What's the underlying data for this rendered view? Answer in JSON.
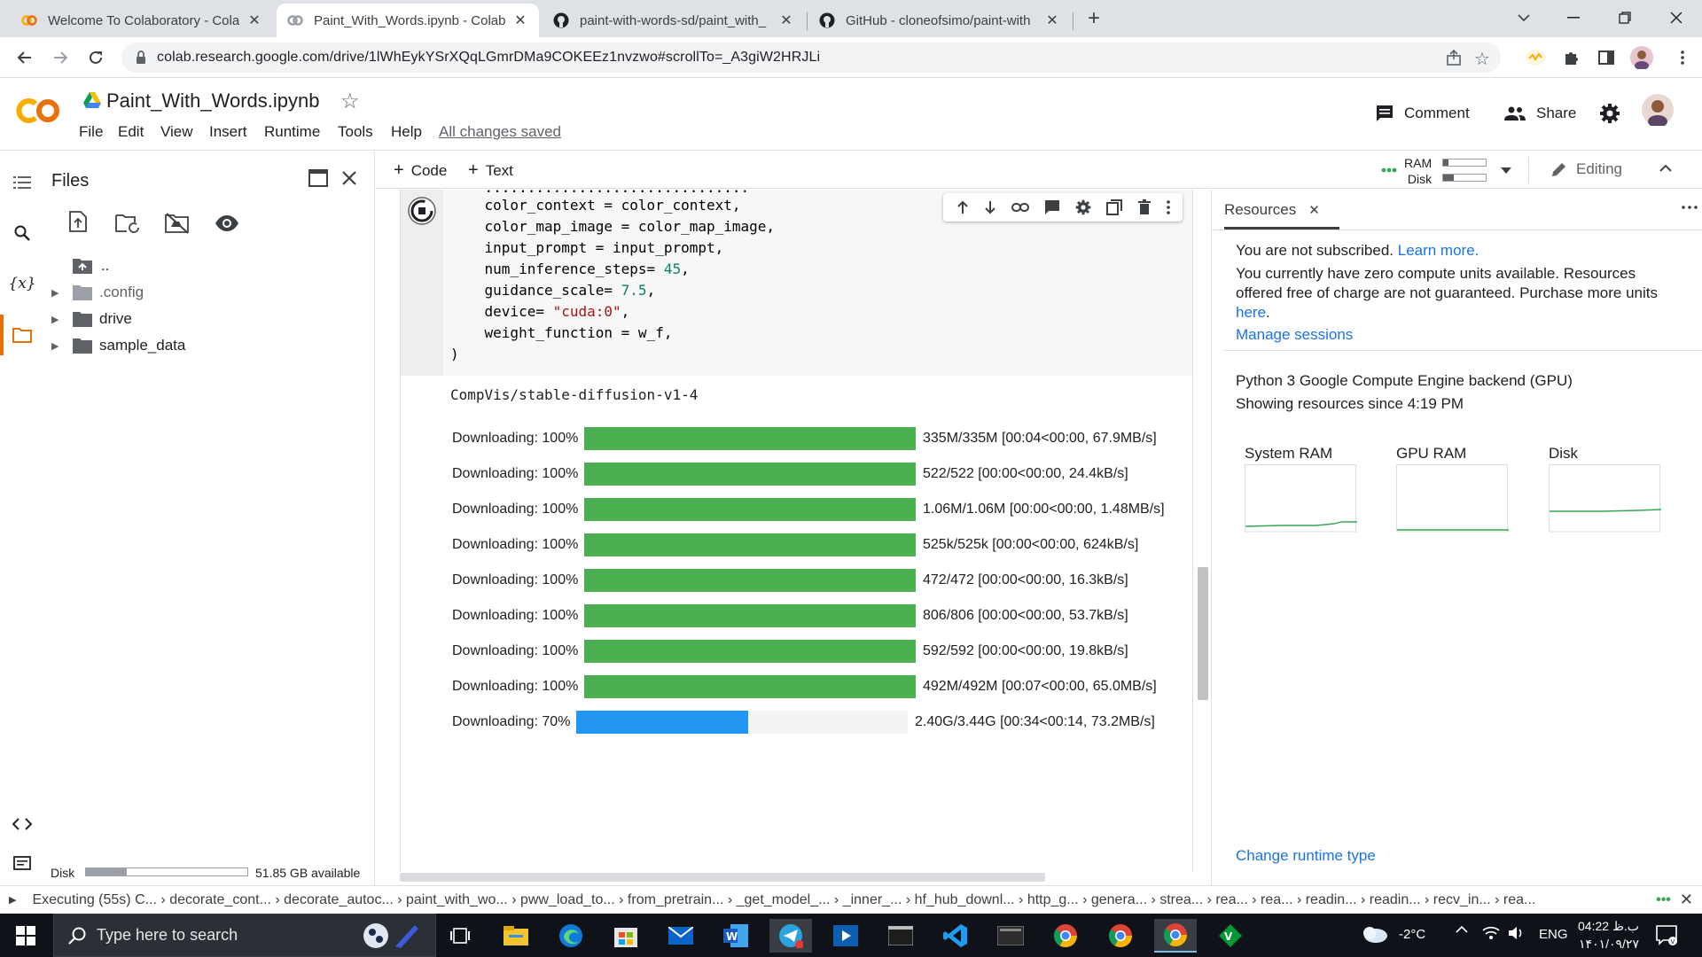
{
  "browser": {
    "tabs": [
      {
        "title": "Welcome To Colaboratory - Colal",
        "favicon": "colab-icon"
      },
      {
        "title": "Paint_With_Words.ipynb - Colabo",
        "favicon": "colab-icon"
      },
      {
        "title": "paint-with-words-sd/paint_with_",
        "favicon": "github-icon"
      },
      {
        "title": "GitHub - cloneofsimo/paint-with",
        "favicon": "github-icon"
      }
    ],
    "url": "colab.research.google.com/drive/1lWhEykYSrXQqLGmrDMa9COKEEz1nvzwo#scrollTo=_A3giW2HRJLi"
  },
  "colab": {
    "doc_title": "Paint_With_Words.ipynb",
    "menu": [
      "File",
      "Edit",
      "View",
      "Insert",
      "Runtime",
      "Tools",
      "Help"
    ],
    "saved_status": "All changes saved",
    "comment_label": "Comment",
    "share_label": "Share",
    "add_code": "Code",
    "add_text": "Text",
    "ram_label": "RAM",
    "disk_label": "Disk",
    "editing_label": "Editing"
  },
  "files": {
    "title": "Files",
    "items": [
      {
        "name": "..",
        "type": "up"
      },
      {
        "name": ".config",
        "type": "folder"
      },
      {
        "name": "drive",
        "type": "folder"
      },
      {
        "name": "sample_data",
        "type": "folder"
      }
    ],
    "disk_label": "Disk",
    "disk_available": "51.85 GB available",
    "disk_used_fraction": 0.25
  },
  "code": {
    "lines": [
      "color_context = color_context,",
      "color_map_image = color_map_image,",
      "input_prompt = input_prompt,",
      "num_inference_steps= 45,",
      "guidance_scale= 7.5,",
      "device= \"cuda:0\",",
      "weight_function = w_f,",
      ")"
    ]
  },
  "output": {
    "model": "CompVis/stable-diffusion-v1-4",
    "downloads": [
      {
        "label": "Downloading: 100%",
        "progress": 1.0,
        "stats": "335M/335M [00:04<00:00, 67.9MB/s]"
      },
      {
        "label": "Downloading: 100%",
        "progress": 1.0,
        "stats": "522/522 [00:00<00:00, 24.4kB/s]"
      },
      {
        "label": "Downloading: 100%",
        "progress": 1.0,
        "stats": "1.06M/1.06M [00:00<00:00, 1.48MB/s]"
      },
      {
        "label": "Downloading: 100%",
        "progress": 1.0,
        "stats": "525k/525k [00:00<00:00, 624kB/s]"
      },
      {
        "label": "Downloading: 100%",
        "progress": 1.0,
        "stats": "472/472 [00:00<00:00, 16.3kB/s]"
      },
      {
        "label": "Downloading: 100%",
        "progress": 1.0,
        "stats": "806/806 [00:00<00:00, 53.7kB/s]"
      },
      {
        "label": "Downloading: 100%",
        "progress": 1.0,
        "stats": "592/592 [00:00<00:00, 19.8kB/s]"
      },
      {
        "label": "Downloading: 100%",
        "progress": 1.0,
        "stats": "492M/492M [00:07<00:00, 65.0MB/s]"
      },
      {
        "label": "Downloading: 70%",
        "progress": 0.7,
        "stats": "2.40G/3.44G [00:34<00:14, 73.2MB/s]"
      }
    ],
    "colors": {
      "complete": "#4caf50",
      "active": "#2196f3"
    }
  },
  "resources": {
    "tab_label": "Resources",
    "not_subscribed": "You are not subscribed.",
    "learn_more": "Learn more.",
    "compute_text": "You currently have zero compute units available. Resources offered free of charge are not guaranteed. Purchase more units",
    "here": "here",
    "manage_sessions": "Manage sessions",
    "backend": "Python 3 Google Compute Engine backend (GPU)",
    "since": "Showing resources since 4:19 PM",
    "charts": [
      "System RAM",
      "GPU RAM",
      "Disk"
    ],
    "change_runtime": "Change runtime type"
  },
  "statusbar": {
    "text": "Executing (55s)  C... › decorate_cont... › decorate_autoc... › paint_with_wo... › pww_load_to... › from_pretrain... › _get_model_... › _inner_... › hf_hub_downl... › http_g... › genera... › strea... › rea... › rea... › readin... › readin... › recv_in... › rea..."
  },
  "taskbar": {
    "search_placeholder": "Type here to search",
    "weather": "-2°C",
    "language": "ENG",
    "time": "04:22 ب.ظ",
    "date": "۱۴۰۱/۰۹/۲۷"
  }
}
